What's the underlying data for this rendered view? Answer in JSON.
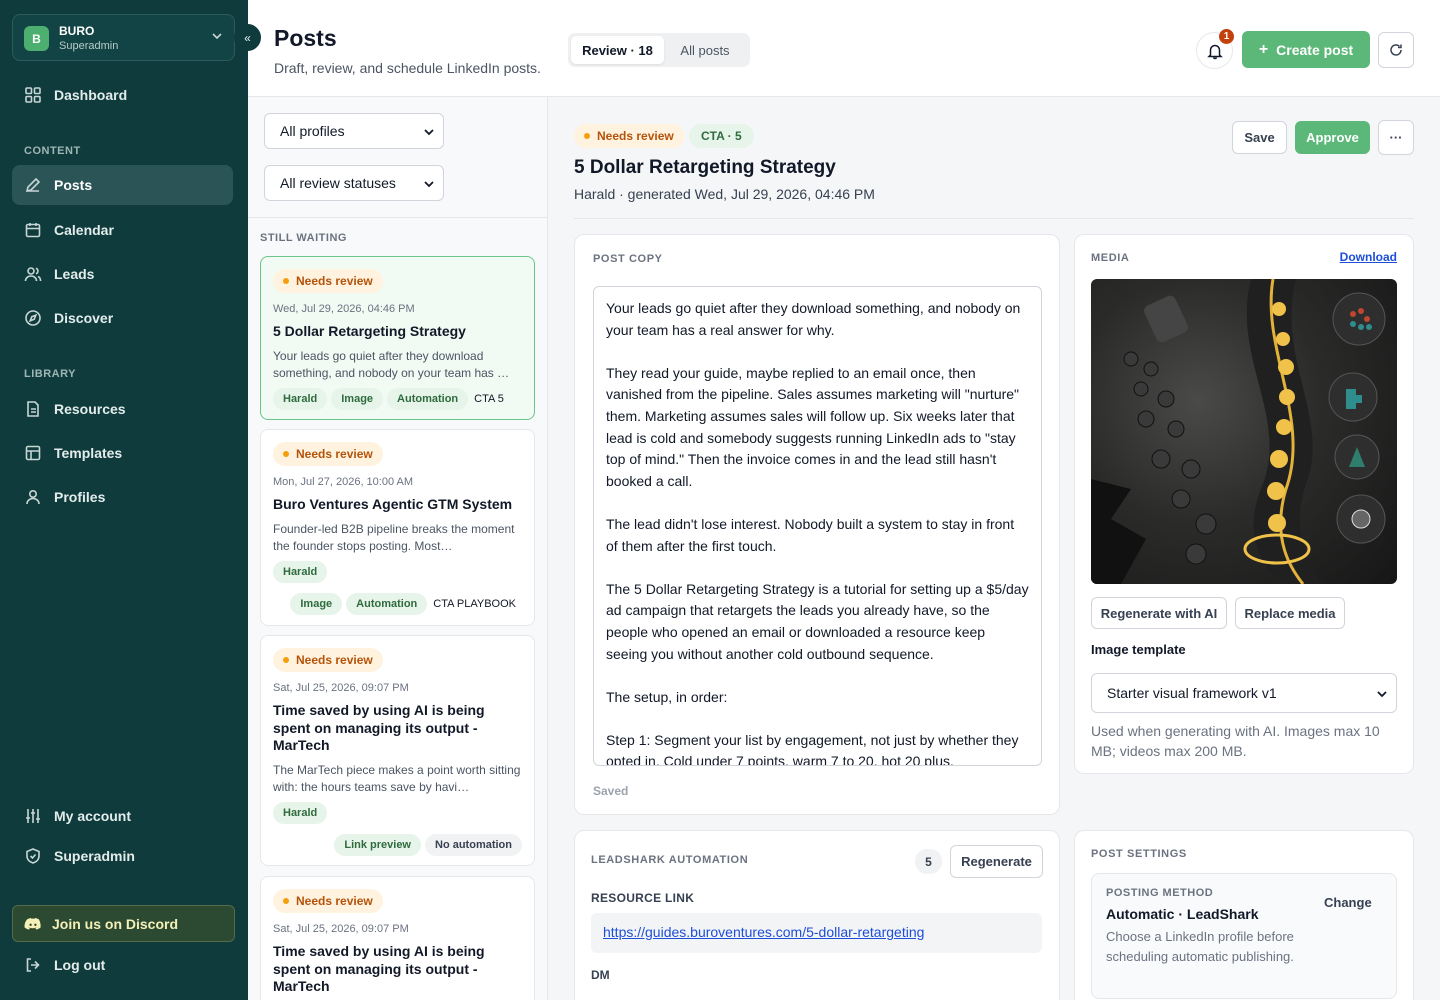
{
  "sidebar": {
    "workspace": {
      "initial": "B",
      "name": "BURO",
      "role": "Superadmin"
    },
    "collapse_glyph": "«",
    "nav_top": [
      {
        "label": "Dashboard",
        "icon": "grid-icon"
      }
    ],
    "content_label": "CONTENT",
    "content_items": [
      {
        "label": "Posts",
        "icon": "pencil-icon",
        "active": true
      },
      {
        "label": "Calendar",
        "icon": "calendar-icon"
      },
      {
        "label": "Leads",
        "icon": "users-icon"
      },
      {
        "label": "Discover",
        "icon": "compass-icon"
      }
    ],
    "library_label": "LIBRARY",
    "library_items": [
      {
        "label": "Resources",
        "icon": "file-icon"
      },
      {
        "label": "Templates",
        "icon": "template-icon"
      },
      {
        "label": "Profiles",
        "icon": "user-icon"
      }
    ],
    "bottom_items": [
      {
        "label": "My account",
        "icon": "sliders-icon"
      },
      {
        "label": "Superadmin",
        "icon": "shield-icon"
      }
    ],
    "discord": "Join us on Discord",
    "logout": "Log out"
  },
  "header": {
    "title": "Posts",
    "subtitle": "Draft, review, and schedule LinkedIn posts.",
    "tabs": [
      {
        "label": "Review · 18",
        "active": true
      },
      {
        "label": "All posts",
        "active": false
      }
    ],
    "bell_count": "1",
    "create_label": "Create post"
  },
  "filters": {
    "profile": "All profiles",
    "status": "All review statuses"
  },
  "list": {
    "section_label": "STILL WAITING",
    "cards": [
      {
        "status": "Needs review",
        "date": "Wed, Jul 29, 2026, 04:46 PM",
        "title": "5 Dollar Retargeting Strategy",
        "excerpt": "Your leads go quiet after they download something, and nobody on your team has …",
        "tags": [
          "Harald",
          "Image",
          "Automation"
        ],
        "cta": "CTA 5"
      },
      {
        "status": "Needs review",
        "date": "Mon, Jul 27, 2026, 10:00 AM",
        "title": "Buro Ventures Agentic GTM System",
        "excerpt": "Founder-led B2B pipeline breaks the moment the founder stops posting. Most…",
        "tags": [
          "Harald"
        ],
        "tags2": [
          "Image",
          "Automation"
        ],
        "cta": "CTA PLAYBOOK"
      },
      {
        "status": "Needs review",
        "date": "Sat, Jul 25, 2026, 09:07 PM",
        "title": "Time saved by using AI is being spent on managing its output - MarTech",
        "excerpt": "The MarTech piece makes a point worth sitting with: the hours teams save by havi…",
        "tags": [
          "Harald"
        ],
        "tags2": [
          "Link preview",
          "No automation"
        ]
      },
      {
        "status": "Needs review",
        "date": "Sat, Jul 25, 2026, 09:07 PM",
        "title": "Time saved by using AI is being spent on managing its output - MarTech"
      }
    ]
  },
  "detail": {
    "status": "Needs review",
    "cta_badge": "CTA · 5",
    "title": "5 Dollar Retargeting Strategy",
    "meta": "Harald · generated Wed, Jul 29, 2026, 04:46 PM",
    "save_label": "Save",
    "approve_label": "Approve",
    "more_glyph": "···",
    "post_copy_label": "POST COPY",
    "post_copy": "Your leads go quiet after they download something, and nobody on your team has a real answer for why.\n\nThey read your guide, maybe replied to an email once, then vanished from the pipeline. Sales assumes marketing will \"nurture\" them. Marketing assumes sales will follow up. Six weeks later that lead is cold and somebody suggests running LinkedIn ads to \"stay top of mind.\" Then the invoice comes in and the lead still hasn't booked a call.\n\nThe lead didn't lose interest. Nobody built a system to stay in front of them after the first touch.\n\nThe 5 Dollar Retargeting Strategy is a tutorial for setting up a $5/day ad campaign that retargets the leads you already have, so the people who opened an email or downloaded a resource keep seeing you without another cold outbound sequence.\n\nThe setup, in order:\n\nStep 1: Segment your list by engagement, not just by whether they opted in. Cold under 7 points, warm 7 to 20, hot 20 plus.",
    "saved_label": "Saved",
    "media": {
      "label": "MEDIA",
      "download": "Download",
      "regenerate": "Regenerate with AI",
      "replace": "Replace media",
      "template_label": "Image template",
      "template_value": "Starter visual framework v1",
      "help": "Used when generating with AI. Images max 10 MB; videos max 200 MB."
    },
    "automation": {
      "label": "LEADSHARK AUTOMATION",
      "count": "5",
      "regenerate": "Regenerate",
      "resource_label": "RESOURCE LINK",
      "resource_url": "https://guides.buroventures.com/5-dollar-retargeting",
      "dm_label": "DM"
    },
    "settings": {
      "label": "POST SETTINGS",
      "method_label": "POSTING METHOD",
      "method_value": "Automatic · LeadShark",
      "method_help": "Choose a LinkedIn profile before scheduling automatic publishing.",
      "change": "Change"
    }
  },
  "colors": {
    "sidebar": "#0f3b3c",
    "accent_green": "#5cb878",
    "warning": "#b45309",
    "link": "#1d4ed8"
  }
}
